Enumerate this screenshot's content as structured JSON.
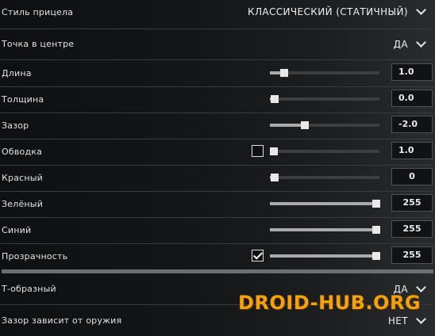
{
  "colors": {
    "accent_watermark": "#f5a10d",
    "slider_fill": "#aaaaaa",
    "slider_track": "#3d3e40"
  },
  "settings": {
    "style": {
      "label": "Стиль прицела",
      "value": "КЛАССИЧЕСКИЙ (СТАТИЧНЫЙ)"
    },
    "center_dot": {
      "label": "Точка в центре",
      "value": "ДА"
    },
    "sliders": [
      {
        "label": "Длина",
        "value": "1.0",
        "fraction": 0.13
      },
      {
        "label": "Толщина",
        "value": "0.0",
        "fraction": 0.04
      },
      {
        "label": "Зазор",
        "value": "-2.0",
        "fraction": 0.32
      },
      {
        "label": "Обводка",
        "value": "1.0",
        "fraction": 0.0,
        "checkbox": false
      },
      {
        "label": "Красный",
        "value": "0",
        "fraction": 0.04
      },
      {
        "label": "Зелёный",
        "value": "255",
        "fraction": 0.97
      },
      {
        "label": "Синий",
        "value": "255",
        "fraction": 0.97
      },
      {
        "label": "Прозрачность",
        "value": "255",
        "fraction": 0.97,
        "checkbox": true
      }
    ],
    "t_shaped": {
      "label": "Т-образный",
      "value": "ДА"
    },
    "weapon_gap": {
      "label": "Зазор зависит от оружия",
      "value": "НЕТ"
    }
  },
  "watermark": "DROID-HUB.ORG"
}
